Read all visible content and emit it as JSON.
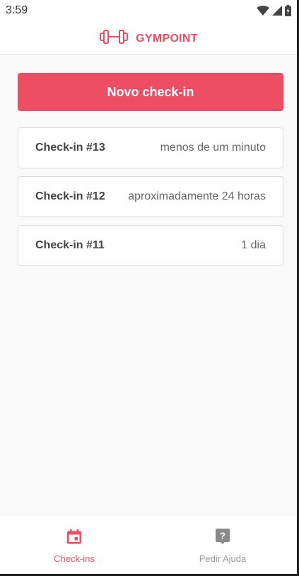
{
  "status_bar": {
    "time": "3:59",
    "icons": [
      "wifi-icon",
      "signal-icon",
      "battery-icon"
    ]
  },
  "header": {
    "brand": "GYMPOINT",
    "logo_icon": "dumbbell-icon"
  },
  "main": {
    "new_checkin_label": "Novo check-in",
    "checkins": [
      {
        "title": "Check-in #13",
        "time": "menos de um minuto"
      },
      {
        "title": "Check-in #12",
        "time": "aproximadamente 24 horas"
      },
      {
        "title": "Check-in #11",
        "time": "1 dia"
      }
    ]
  },
  "tabs": [
    {
      "label": "Check-ins",
      "icon": "calendar-icon",
      "active": true
    },
    {
      "label": "Pedir Ajuda",
      "icon": "help-icon",
      "active": false
    }
  ],
  "colors": {
    "brand": "#ee4d64",
    "background": "#f9f9f9",
    "inactive": "#999999"
  }
}
